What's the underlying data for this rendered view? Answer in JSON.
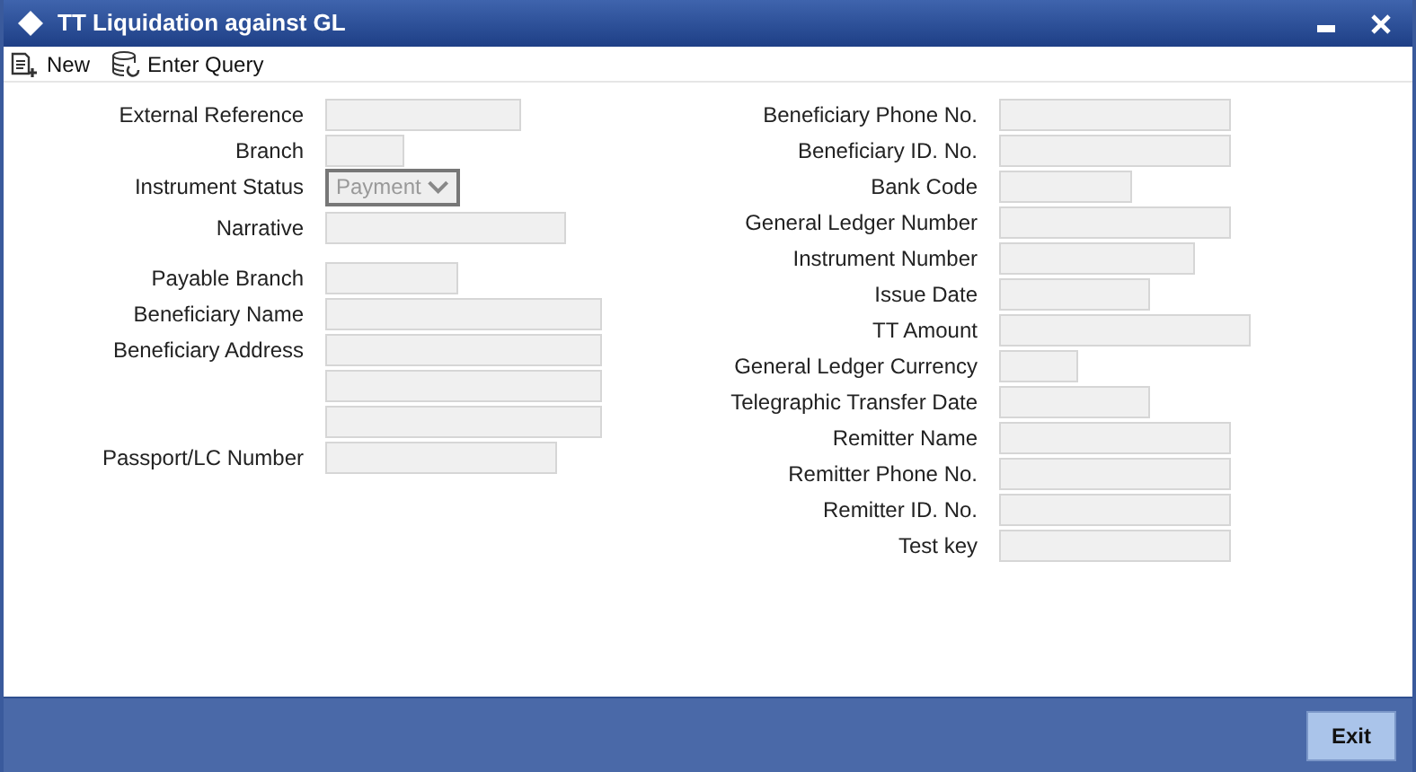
{
  "window": {
    "title": "TT Liquidation against GL"
  },
  "toolbar": [
    {
      "kind": "new",
      "label": "New"
    },
    {
      "kind": "query",
      "label": "Enter Query"
    }
  ],
  "left_fields": [
    {
      "kind": "text",
      "label": "External Reference"
    },
    {
      "kind": "text",
      "label": "Branch"
    },
    {
      "kind": "select",
      "label": "Instrument Status",
      "value": "Payment",
      "disabled": true
    },
    {
      "kind": "text",
      "label": "Narrative"
    },
    {
      "kind": "text",
      "label": "Payable Branch"
    },
    {
      "kind": "text",
      "label": "Beneficiary Name"
    },
    {
      "kind": "text",
      "label": "Beneficiary Address"
    },
    {
      "kind": "text"
    },
    {
      "kind": "text"
    },
    {
      "kind": "text",
      "label": "Passport/LC Number"
    }
  ],
  "right_fields": [
    {
      "kind": "text",
      "label": "Beneficiary Phone No."
    },
    {
      "kind": "text",
      "label": "Beneficiary ID. No."
    },
    {
      "kind": "text",
      "label": "Bank Code"
    },
    {
      "kind": "text",
      "label": "General Ledger Number"
    },
    {
      "kind": "text",
      "label": "Instrument Number"
    },
    {
      "kind": "text",
      "label": "Issue Date"
    },
    {
      "kind": "text",
      "label": "TT Amount"
    },
    {
      "kind": "text",
      "label": "General Ledger Currency"
    },
    {
      "kind": "text",
      "label": "Telegraphic Transfer Date"
    },
    {
      "kind": "text",
      "label": "Remitter Name"
    },
    {
      "kind": "text",
      "label": "Remitter Phone No."
    },
    {
      "kind": "text",
      "label": "Remitter ID. No."
    },
    {
      "kind": "text",
      "label": "Test key"
    }
  ],
  "buttons": [
    "Exit"
  ]
}
